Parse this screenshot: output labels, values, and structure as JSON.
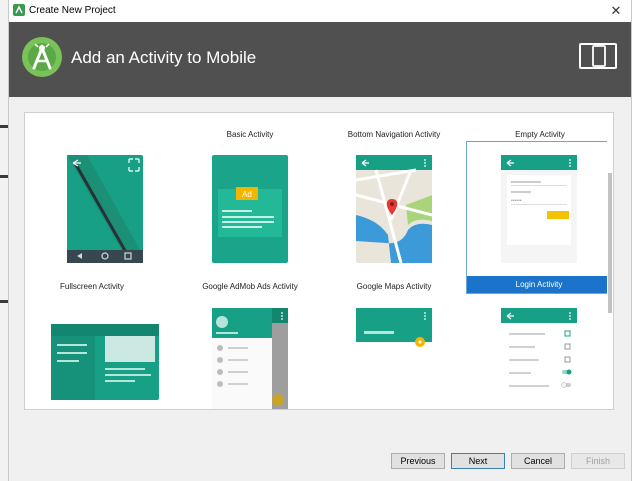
{
  "window": {
    "title": "Create New Project",
    "close_glyph": "✕"
  },
  "header": {
    "title": "Add an Activity to Mobile",
    "logo_icon": "android-studio-logo",
    "device_icon": "phone-tablet-icon",
    "background": "#505050"
  },
  "gallery": {
    "row1_labels": [
      "",
      "Basic Activity",
      "Bottom Navigation Activity",
      "Empty Activity"
    ],
    "row2_labels": [
      "Fullscreen Activity",
      "Google AdMob Ads Activity",
      "Google Maps Activity",
      "Login Activity"
    ],
    "selected": "Login Activity",
    "ad_badge": "Ad",
    "accent": "#15937b",
    "selection_color": "#1b74c9"
  },
  "buttons": {
    "previous": "Previous",
    "next": "Next",
    "cancel": "Cancel",
    "finish": "Finish"
  }
}
